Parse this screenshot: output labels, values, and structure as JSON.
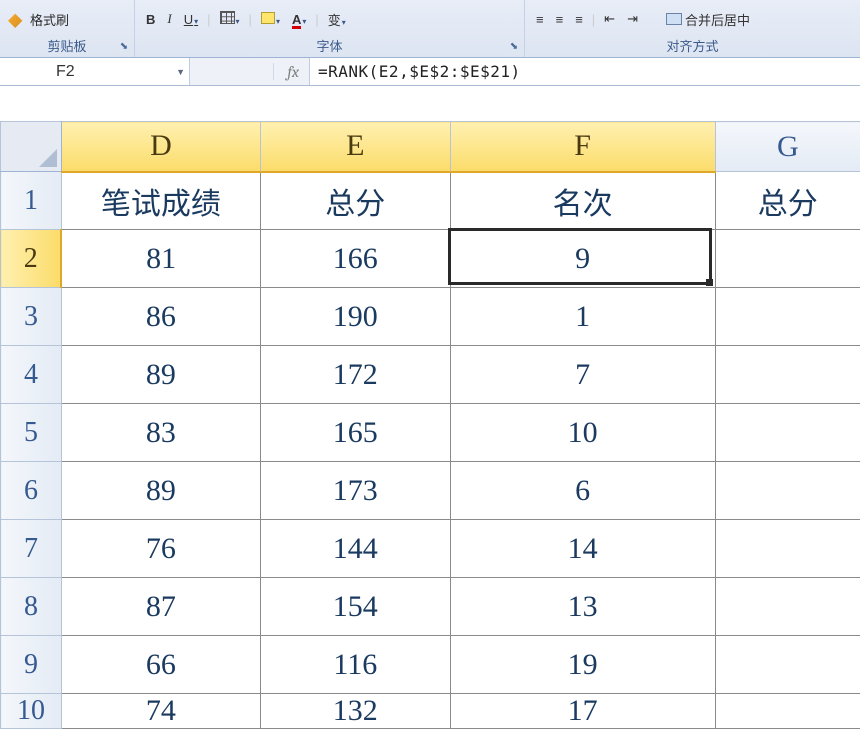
{
  "ribbon": {
    "clipboard": {
      "format_painter": "格式刷",
      "group_label": "剪贴板"
    },
    "font": {
      "bold": "B",
      "italic": "I",
      "underline": "U",
      "font_color_letter": "A",
      "asian_layout": "变",
      "group_label": "字体"
    },
    "alignment": {
      "merge_center": "合并后居中",
      "group_label": "对齐方式"
    }
  },
  "formula_bar": {
    "name_box": "F2",
    "fx": "fx",
    "formula": "=RANK(E2,$E$2:$E$21)"
  },
  "columns": {
    "D": "D",
    "E": "E",
    "F": "F",
    "G": "G"
  },
  "headers": {
    "D": "笔试成绩",
    "E": "总分",
    "F": "名次",
    "G": "总分"
  },
  "rows": [
    {
      "n": "1"
    },
    {
      "n": "2",
      "D": "81",
      "E": "166",
      "F": "9"
    },
    {
      "n": "3",
      "D": "86",
      "E": "190",
      "F": "1"
    },
    {
      "n": "4",
      "D": "89",
      "E": "172",
      "F": "7"
    },
    {
      "n": "5",
      "D": "83",
      "E": "165",
      "F": "10"
    },
    {
      "n": "6",
      "D": "89",
      "E": "173",
      "F": "6"
    },
    {
      "n": "7",
      "D": "76",
      "E": "144",
      "F": "14"
    },
    {
      "n": "8",
      "D": "87",
      "E": "154",
      "F": "13"
    },
    {
      "n": "9",
      "D": "66",
      "E": "116",
      "F": "19"
    },
    {
      "n": "10",
      "D": "74",
      "E": "132",
      "F": "17"
    }
  ],
  "selection": {
    "cell": "F2"
  }
}
